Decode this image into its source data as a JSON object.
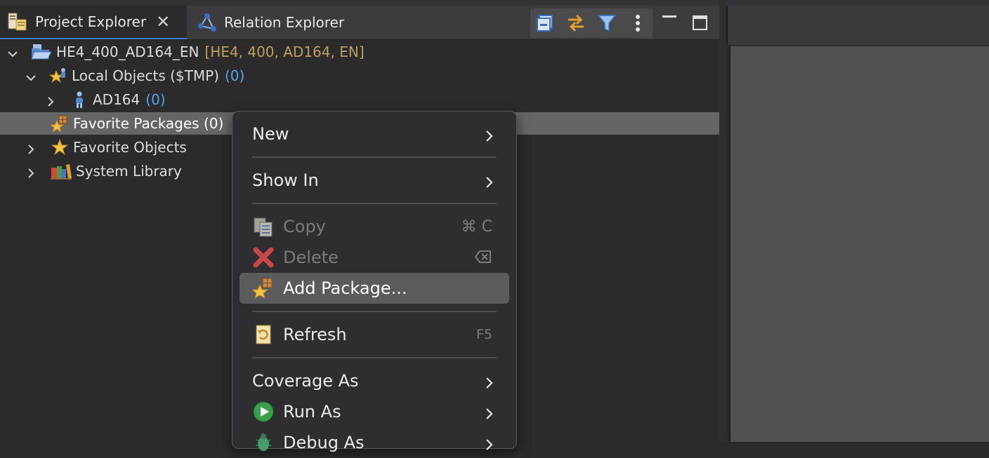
{
  "tabs": {
    "project_explorer": "Project Explorer",
    "relation_explorer": "Relation Explorer"
  },
  "toolbar": {
    "icons": [
      "collapse-all-icon",
      "link-with-editor-icon",
      "filter-icon",
      "view-menu-icon"
    ],
    "window": [
      "minimize-icon",
      "maximize-icon"
    ]
  },
  "tree": {
    "project": {
      "name": "HE4_400_AD164_EN",
      "decoration": "[HE4, 400, AD164, EN]"
    },
    "local_objects": {
      "label": "Local Objects ($TMP)",
      "count": "(0)"
    },
    "ad164": {
      "label": "AD164",
      "count": "(0)"
    },
    "favorite_packages": {
      "label": "Favorite Packages (0)"
    },
    "favorite_objects": {
      "label": "Favorite Objects"
    },
    "system_library": {
      "label": "System Library"
    }
  },
  "menu": {
    "new": "New",
    "show_in": "Show In",
    "copy": "Copy",
    "copy_shortcut": "⌘ C",
    "delete": "Delete",
    "add_package": "Add Package...",
    "refresh": "Refresh",
    "refresh_shortcut": "F5",
    "coverage_as": "Coverage As",
    "run_as": "Run As",
    "debug_as": "Debug As"
  },
  "colors": {
    "selection": "#656565",
    "count_blue": "#5aa0e6",
    "decoration_gold": "#bf9f5f",
    "active_tab_underline": "#3d7bd6"
  }
}
